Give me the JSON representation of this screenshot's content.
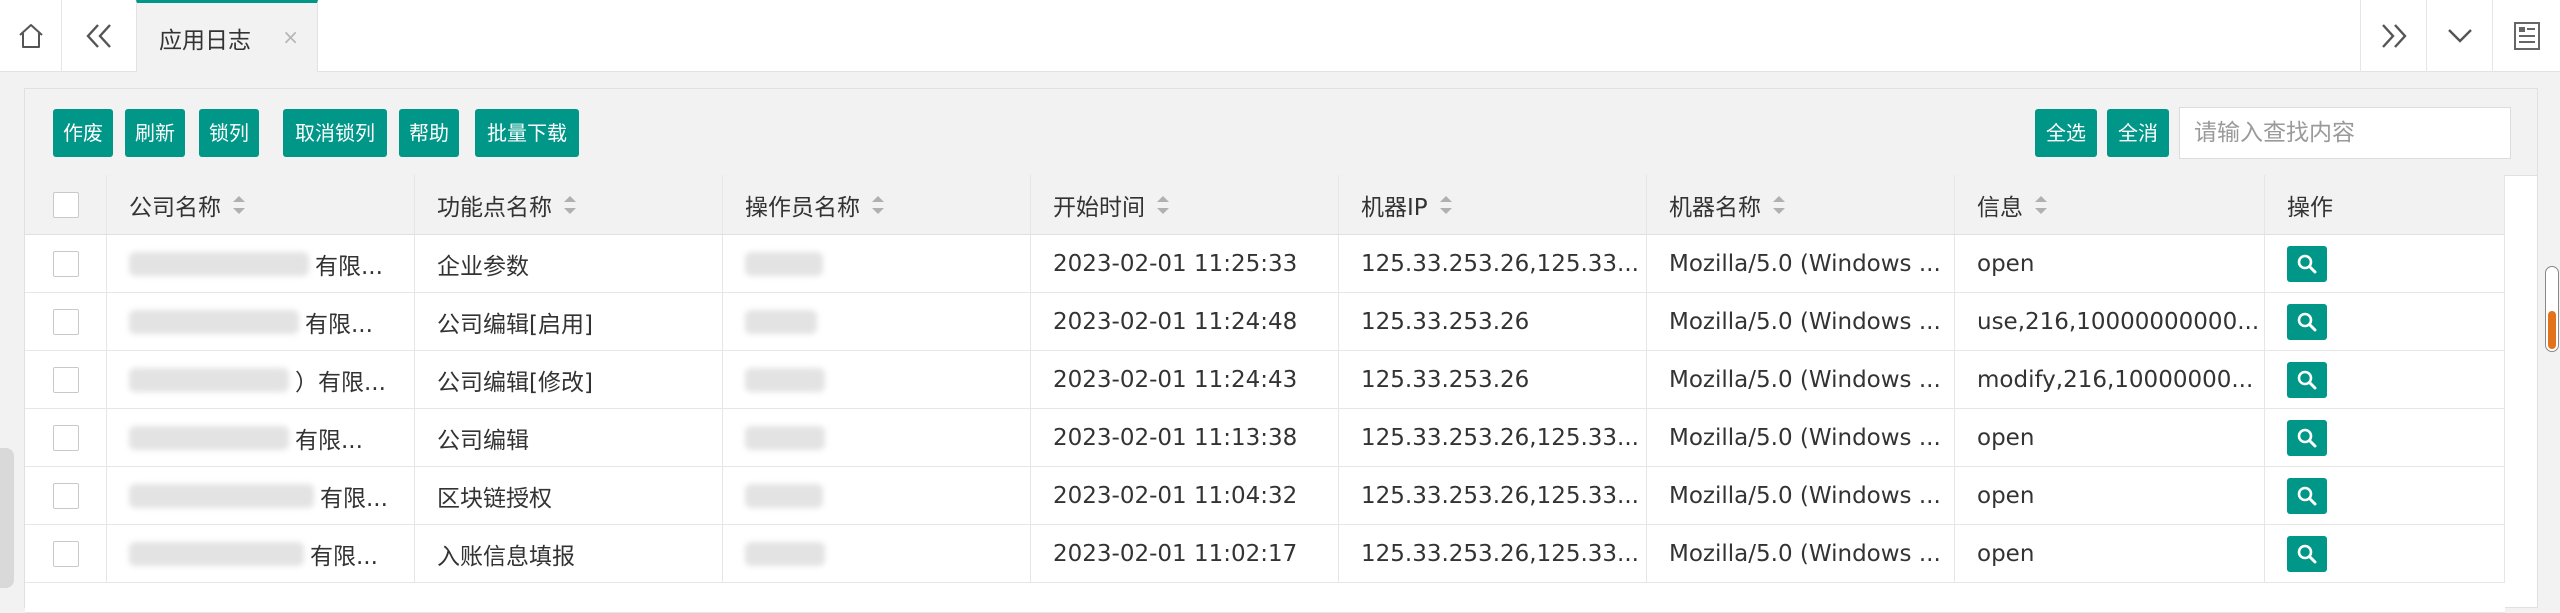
{
  "tab": {
    "title": "应用日志",
    "close": "×"
  },
  "toolbar": {
    "buttons": [
      "作废",
      "刷新",
      "锁列",
      "取消锁列",
      "帮助",
      "批量下载"
    ],
    "select_all": "全选",
    "deselect_all": "全消",
    "search_placeholder": "请输入查找内容"
  },
  "table": {
    "columns": [
      "公司名称",
      "功能点名称",
      "操作员名称",
      "开始时间",
      "机器IP",
      "机器名称",
      "信息",
      "操作"
    ],
    "rows": [
      {
        "company": "有限...",
        "function": "企业参数",
        "operator": "",
        "start_time": "2023-02-01 11:25:33",
        "ip": "125.33.253.26,125.33...",
        "machine": "Mozilla/5.0 (Windows ...",
        "info": "open"
      },
      {
        "company": "有限...",
        "function": "公司编辑[启用]",
        "operator": "",
        "start_time": "2023-02-01 11:24:48",
        "ip": "125.33.253.26",
        "machine": "Mozilla/5.0 (Windows ...",
        "info": "use,216,10000000000..."
      },
      {
        "company": "）有限...",
        "function": "公司编辑[修改]",
        "operator": "",
        "start_time": "2023-02-01 11:24:43",
        "ip": "125.33.253.26",
        "machine": "Mozilla/5.0 (Windows ...",
        "info": "modify,216,10000000..."
      },
      {
        "company": "有限...",
        "function": "公司编辑",
        "operator": "",
        "start_time": "2023-02-01 11:13:38",
        "ip": "125.33.253.26,125.33...",
        "machine": "Mozilla/5.0 (Windows ...",
        "info": "open"
      },
      {
        "company": "有限...",
        "function": "区块链授权",
        "operator": "",
        "start_time": "2023-02-01 11:04:32",
        "ip": "125.33.253.26,125.33...",
        "machine": "Mozilla/5.0 (Windows ...",
        "info": "open"
      },
      {
        "company": "有限...",
        "function": "入账信息填报",
        "operator": "",
        "start_time": "2023-02-01 11:02:17",
        "ip": "125.33.253.26,125.33...",
        "machine": "Mozilla/5.0 (Windows ...",
        "info": "open"
      }
    ]
  },
  "colors": {
    "accent": "#009688",
    "scrollbar_thumb": "#e2731a"
  },
  "icons": {
    "home": "home-icon",
    "prev": "double-chevron-left-icon",
    "next": "double-chevron-right-icon",
    "dropdown": "chevron-down-icon",
    "page": "page-list-icon",
    "view": "search-icon"
  }
}
